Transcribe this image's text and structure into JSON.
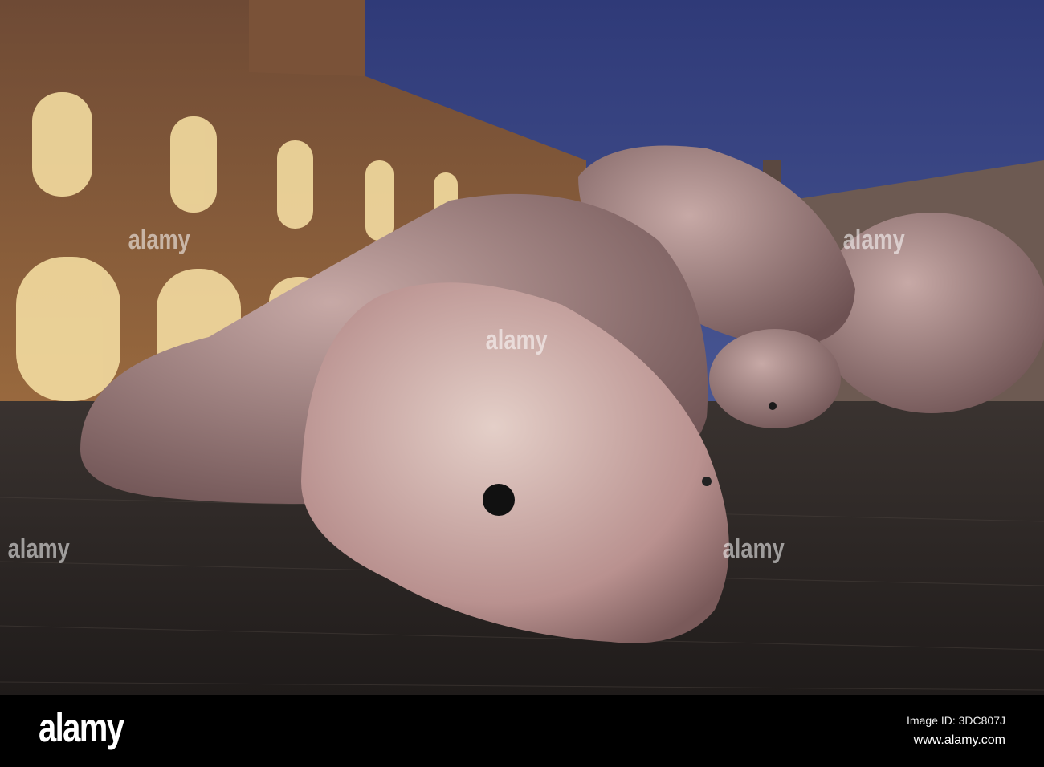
{
  "watermark": "alamy",
  "footer": {
    "logo": "alamy",
    "image_id": "Image ID: 3DC807J",
    "website": "www.alamy.com"
  },
  "colors": {
    "sky": "#3f4d86",
    "stone": "#c9a9a6",
    "pavement": "#2a2624",
    "building": "#8a6245"
  }
}
